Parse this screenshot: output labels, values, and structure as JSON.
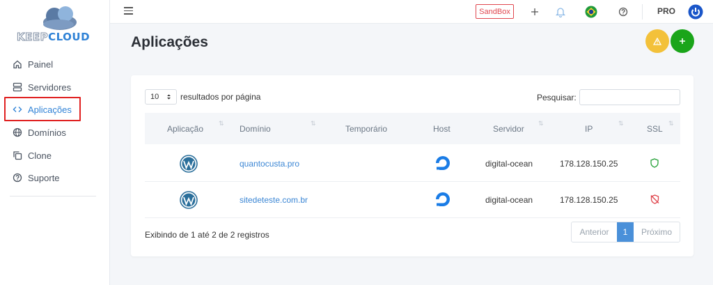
{
  "brand": {
    "logo_word_1": "KEEP",
    "logo_word_2": "CLOUD"
  },
  "sidebar": {
    "items": [
      {
        "label": "Painel",
        "icon": "home-icon"
      },
      {
        "label": "Servidores",
        "icon": "server-icon"
      },
      {
        "label": "Aplicações",
        "icon": "code-icon",
        "active": true
      },
      {
        "label": "Domínios",
        "icon": "globe-icon"
      },
      {
        "label": "Clone",
        "icon": "copy-icon"
      },
      {
        "label": "Suporte",
        "icon": "help-icon"
      }
    ]
  },
  "topbar": {
    "sandbox_label": "SandBox",
    "plan_label": "PRO"
  },
  "page": {
    "title": "Aplicações"
  },
  "table": {
    "page_size": "10",
    "per_page_label": "resultados por página",
    "search_label": "Pesquisar:",
    "search_value": "",
    "columns": [
      "Aplicação",
      "Domínio",
      "Temporário",
      "Host",
      "Servidor",
      "IP",
      "SSL"
    ],
    "rows": [
      {
        "app": "wordpress-icon",
        "domain": "quantocusta.pro",
        "temp": "",
        "host": "digitalocean-icon",
        "server": "digital-ocean",
        "ip": "178.128.150.25",
        "ssl": "shield-check-icon"
      },
      {
        "app": "wordpress-icon",
        "domain": "sitedeteste.com.br",
        "temp": "",
        "host": "digitalocean-icon",
        "server": "digital-ocean",
        "ip": "178.128.150.25",
        "ssl": "shield-off-icon"
      }
    ],
    "info": "Exibindo de 1 até 2 de 2 registros",
    "pagination": {
      "prev": "Anterior",
      "current": "1",
      "next": "Próximo"
    }
  },
  "colors": {
    "accent": "#2f82d6",
    "warning": "#f3c13a",
    "success": "#1aa51a",
    "danger": "#e0464e",
    "ssl_ok": "#23a036",
    "ssl_bad": "#e0464e"
  }
}
